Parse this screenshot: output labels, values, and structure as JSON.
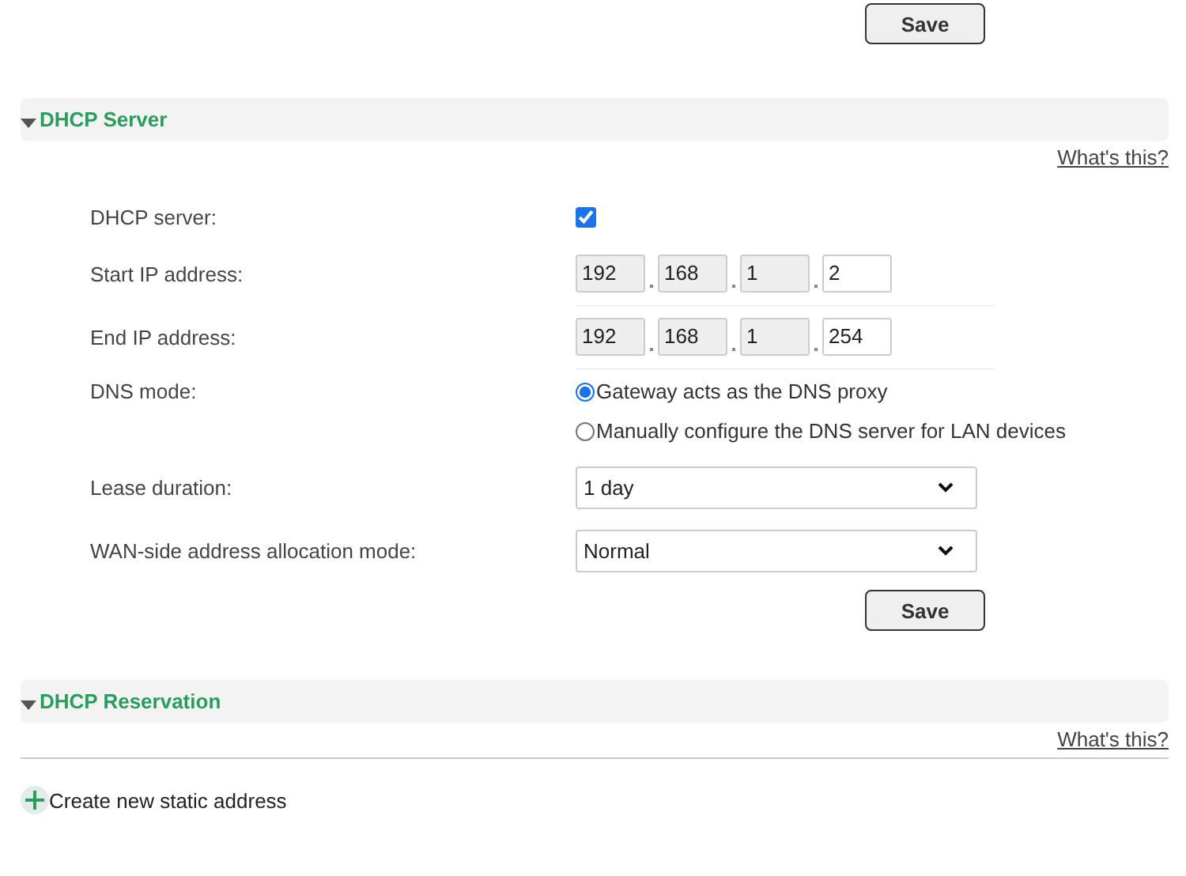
{
  "top_save": "Save",
  "sections": [
    {
      "title": "DHCP Server",
      "expanded": true,
      "help_link": "What's this?",
      "fields": [
        {
          "kind": "checkbox",
          "label": "DHCP server:",
          "checked": true
        },
        {
          "kind": "ip",
          "label": "Start IP address:",
          "octets": [
            {
              "value": "192",
              "disabled": true
            },
            {
              "value": "168",
              "disabled": true
            },
            {
              "value": "1",
              "disabled": true
            },
            {
              "value": "2",
              "disabled": false
            }
          ]
        },
        {
          "kind": "ip",
          "label": "End IP address:",
          "octets": [
            {
              "value": "192",
              "disabled": true
            },
            {
              "value": "168",
              "disabled": true
            },
            {
              "value": "1",
              "disabled": true
            },
            {
              "value": "254",
              "disabled": false
            }
          ]
        },
        {
          "kind": "radio",
          "label": "DNS mode:",
          "options": [
            {
              "label": "Gateway acts as the DNS proxy",
              "selected": true
            },
            {
              "label": "Manually configure the DNS server for LAN devices",
              "selected": false
            }
          ]
        },
        {
          "kind": "select",
          "label": "Lease duration:",
          "value": "1 day"
        },
        {
          "kind": "select",
          "label": "WAN-side address allocation mode:",
          "value": "Normal"
        }
      ],
      "save": "Save"
    },
    {
      "title": "DHCP Reservation",
      "expanded": true,
      "help_link": "What's this?",
      "action": "Create new static address"
    }
  ]
}
